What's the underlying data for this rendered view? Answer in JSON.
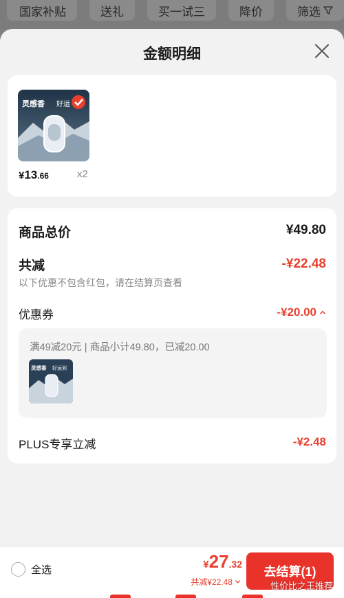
{
  "filters": {
    "items": [
      "国家补贴",
      "送礼",
      "买一试三",
      "降价",
      "筛选"
    ]
  },
  "sheet": {
    "title": "金额明细"
  },
  "product": {
    "image_badge_text": "灵感香",
    "image_badge_text2": "好运",
    "price_symbol": "¥",
    "price_int": "13",
    "price_dec": ".66",
    "quantity": "x2"
  },
  "summary": {
    "total_label": "商品总价",
    "total_value": "¥49.80",
    "reduce_label": "共减",
    "reduce_value": "-¥22.48",
    "note": "以下优惠不包含红包，请在结算页查看",
    "coupon_label": "优惠券",
    "coupon_value": "-¥20.00",
    "coupon_detail": "满49减20元 | 商品小计49.80，已减20.00",
    "coupon_thumb_text": "灵感香",
    "coupon_thumb_text2": "好运到",
    "plus_label": "PLUS专享立减",
    "plus_value": "-¥2.48"
  },
  "bottom": {
    "select_all": "全选",
    "total_symbol": "¥",
    "total_int": "27",
    "total_dec": ".32",
    "reduce_text": "共减¥22.48",
    "checkout_label": "去结算(1)",
    "watermark": "性价比之王推荐"
  },
  "colors": {
    "accent_red": "#e8402f",
    "checkout_red": "#e8322a"
  }
}
